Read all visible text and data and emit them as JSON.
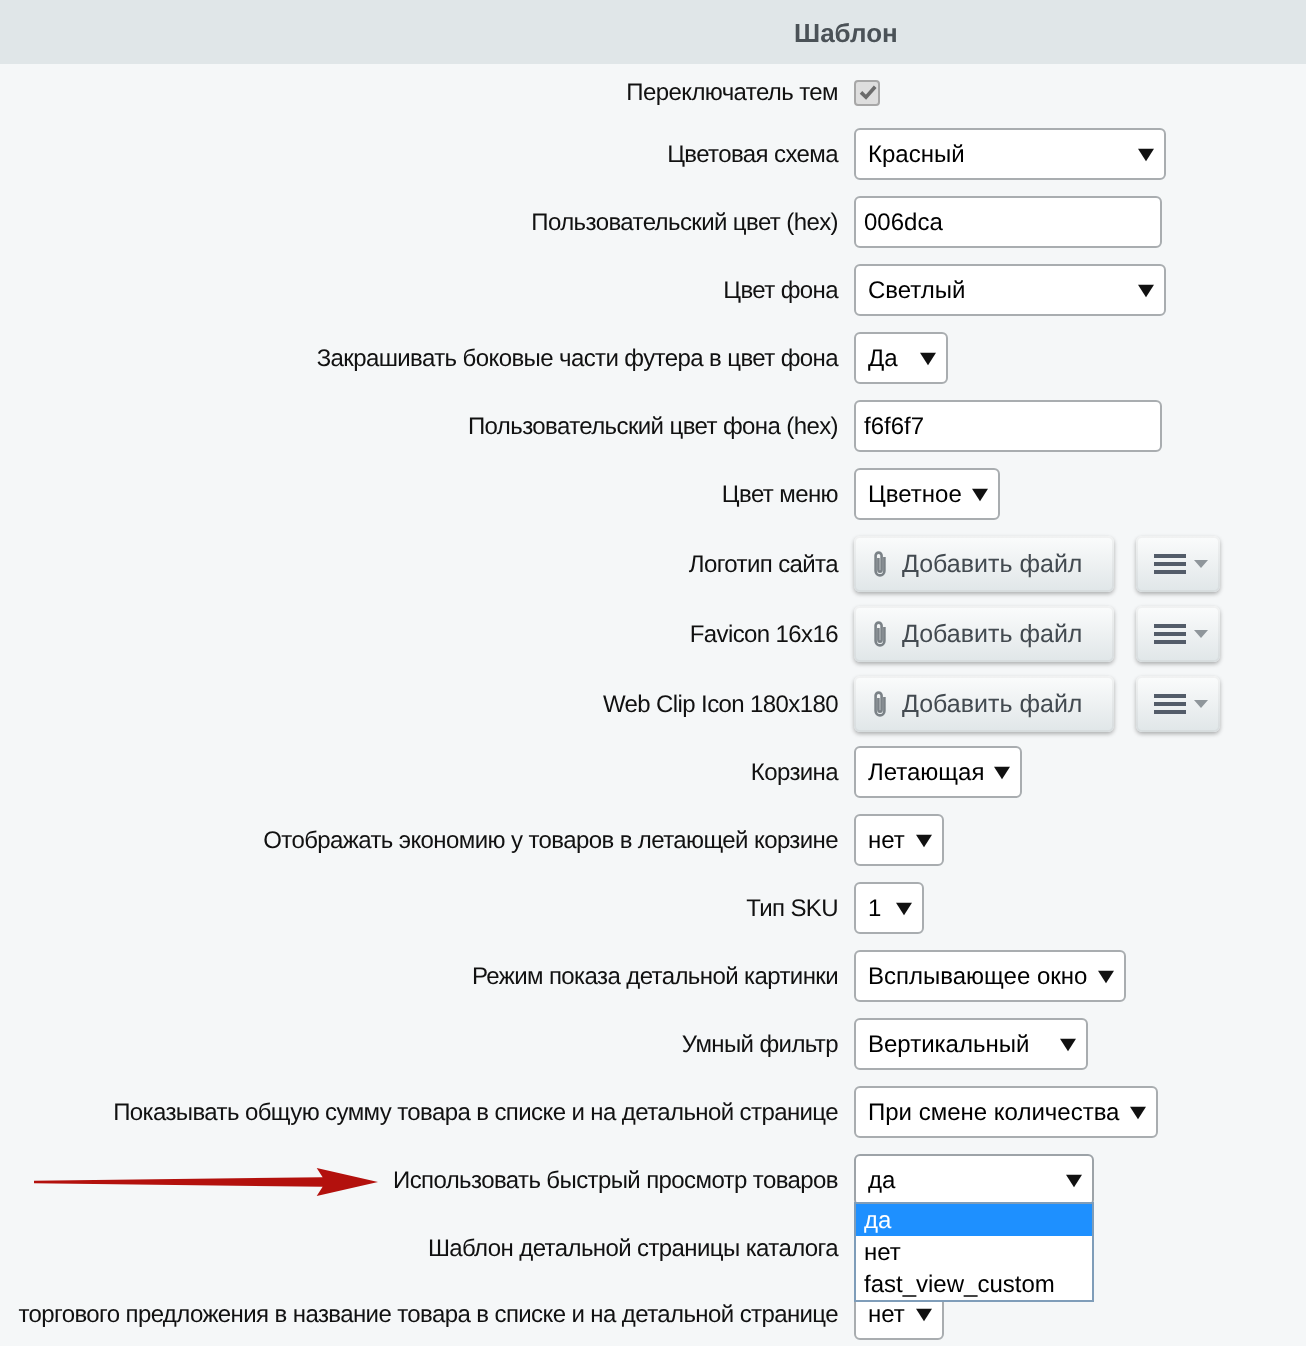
{
  "section": {
    "title": "Шаблон"
  },
  "rows": [
    {
      "label": "Переключатель тем",
      "kind": "checkbox",
      "checked": true,
      "arrow": false
    },
    {
      "label": "Цветовая схема",
      "kind": "select",
      "value": "Красный",
      "expanded": false,
      "arrow": false
    },
    {
      "label": "Пользовательский цвет (hex)",
      "kind": "input",
      "value": "006dca",
      "arrow": false
    },
    {
      "label": "Цвет фона",
      "kind": "select",
      "value": "Светлый",
      "expanded": false,
      "arrow": false
    },
    {
      "label": "Закрашивать боковые части футера в цвет фона",
      "kind": "select",
      "value": "Да",
      "expanded": false,
      "arrow": false
    },
    {
      "label": "Пользовательский цвет фона (hex)",
      "kind": "input",
      "value": "f6f6f7",
      "arrow": false
    },
    {
      "label": "Цвет меню",
      "kind": "select",
      "value": "Цветное",
      "expanded": false,
      "arrow": false
    },
    {
      "label": "Логотип сайта",
      "kind": "file",
      "button": "Добавить файл",
      "arrow": false
    },
    {
      "label": "Favicon 16x16",
      "kind": "file",
      "button": "Добавить файл",
      "arrow": false
    },
    {
      "label": "Web Clip Icon 180x180",
      "kind": "file",
      "button": "Добавить файл",
      "arrow": false
    },
    {
      "label": "Корзина",
      "kind": "select",
      "value": "Летающая",
      "expanded": false,
      "arrow": false
    },
    {
      "label": "Отображать экономию у товаров в летающей корзине",
      "kind": "select",
      "value": "нет",
      "expanded": false,
      "arrow": false
    },
    {
      "label": "Тип SKU",
      "kind": "select",
      "value": "1",
      "expanded": false,
      "arrow": false
    },
    {
      "label": "Режим показа детальной картинки",
      "kind": "select",
      "value": "Всплывающее окно",
      "expanded": false,
      "arrow": false
    },
    {
      "label": "Умный фильтр",
      "kind": "select",
      "value": "Вертикальный",
      "expanded": false,
      "arrow": false
    },
    {
      "label": "Показывать общую сумму товара в списке и на детальной странице",
      "kind": "select",
      "value": "При смене количества",
      "expanded": false,
      "arrow": false
    },
    {
      "label": "Использовать быстрый просмотр товаров",
      "kind": "select",
      "value": "да",
      "expanded": true,
      "arrow": true,
      "options": [
        {
          "label": "да",
          "selected": true
        },
        {
          "label": "нет",
          "selected": false
        },
        {
          "label": "fast_view_custom",
          "selected": false
        }
      ]
    },
    {
      "label": "Шаблон детальной страницы каталога",
      "kind": "label",
      "arrow": false
    },
    {
      "label": "торгового предложения в название товара в списке и на детальной странице",
      "kind": "select",
      "value": "нет",
      "expanded": false,
      "arrow": false
    }
  ]
}
